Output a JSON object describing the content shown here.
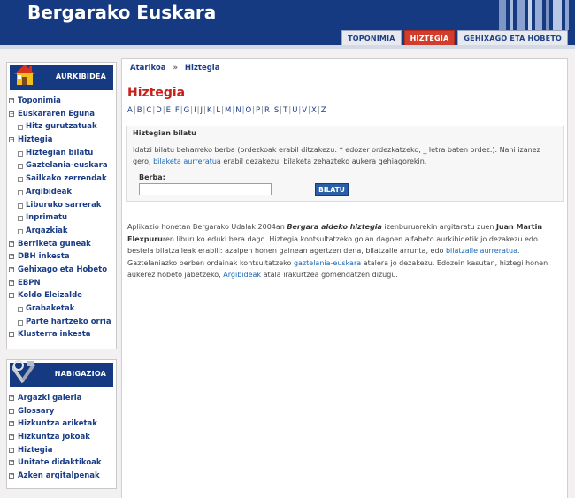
{
  "header": {
    "title": "Bergarako Euskara",
    "tabs": [
      {
        "label": "TOPONIMIA"
      },
      {
        "label": "HIZTEGIA"
      },
      {
        "label": "GEHIXAGO ETA HOBETO"
      }
    ]
  },
  "sidebar": {
    "box1": {
      "title": "AURKIBIDEA",
      "items": [
        {
          "label": "Toponimia"
        },
        {
          "label": "Euskararen Eguna"
        },
        {
          "label": "Hitz gurutzatuak"
        },
        {
          "label": "Hiztegia"
        },
        {
          "label": "Hiztegian bilatu"
        },
        {
          "label": "Gaztelania-euskara"
        },
        {
          "label": "Sailkako zerrendak"
        },
        {
          "label": "Argibideak"
        },
        {
          "label": "Liburuko sarrerak"
        },
        {
          "label": "Inprimatu"
        },
        {
          "label": "Argazkiak"
        },
        {
          "label": "Berriketa guneak"
        },
        {
          "label": "DBH inkesta"
        },
        {
          "label": "Gehixago eta Hobeto"
        },
        {
          "label": "EBPN"
        },
        {
          "label": "Koldo Eleizalde"
        },
        {
          "label": "Grabaketak"
        },
        {
          "label": "Parte hartzeko orria"
        },
        {
          "label": "Klusterra inkesta"
        }
      ]
    },
    "box2": {
      "title": "NABIGAZIOA",
      "items": [
        {
          "label": "Argazki galeria"
        },
        {
          "label": "Glossary"
        },
        {
          "label": "Hizkuntza ariketak"
        },
        {
          "label": "Hizkuntza jokoak"
        },
        {
          "label": "Hiztegia"
        },
        {
          "label": "Unitate didaktikoak"
        },
        {
          "label": "Azken argitalpenak"
        }
      ]
    }
  },
  "main": {
    "breadcrumb": {
      "home": "Atarikoa",
      "sep": "»",
      "current": "Hiztegia"
    },
    "title": "Hiztegia",
    "alphabet": [
      "A",
      "B",
      "C",
      "D",
      "E",
      "F",
      "G",
      "I",
      "J",
      "K",
      "L",
      "M",
      "N",
      "O",
      "P",
      "R",
      "S",
      "T",
      "U",
      "V",
      "X",
      "Z"
    ],
    "search": {
      "legend": "Hiztegian bilatu",
      "desc_1": "Idatzi bilatu beharreko berba (ordezkoak erabil ditzakezu: ",
      "desc_star": "*",
      "desc_2": " edozer ordezkatzeko, _ letra baten ordez.). Nahi izanez gero, ",
      "desc_link": "bilaketa aurreratua",
      "desc_3": " erabil dezakezu, bilaketa zehazteko aukera gehiagorekin.",
      "field_label": "Berba:",
      "input_value": "",
      "button": "BILATU"
    },
    "intro": {
      "p1": "Aplikazio honetan Bergarako Udalak 2004an ",
      "p1_italic": "Bergara aldeko hiztegia",
      "p2": " izenburuarekin argitaratu zuen ",
      "p2_bold": "Juan Martin Elexpuru",
      "p3": "ren liburuko eduki bera dago. Hiztegia kontsultatzeko goian dagoen alfabeto aurkibidetik jo dezakezu edo bestela bilatzaileak erabili: azalpen honen gainean agertzen dena, bilatzaile arrunta, edo ",
      "link1": "bilatzaile aurreratua",
      "p4": ". Gaztelaniazko berben ordainak kontsultatzeko ",
      "link2": "gaztelania-euskara",
      "p5": " atalera jo dezakezu. Edozein kasutan, hiztegi honen aukerez hobeto jabetzeko, ",
      "link3": "Argibideak",
      "p6": " atala irakurtzea gomendatzen dizugu."
    }
  },
  "colors": {
    "brand_blue": "#163a82",
    "active_tab_red": "#d23c2a",
    "title_red": "#c8201a",
    "link_blue": "#1a66b3"
  },
  "icons": [
    "house-icon",
    "tools-icon"
  ]
}
